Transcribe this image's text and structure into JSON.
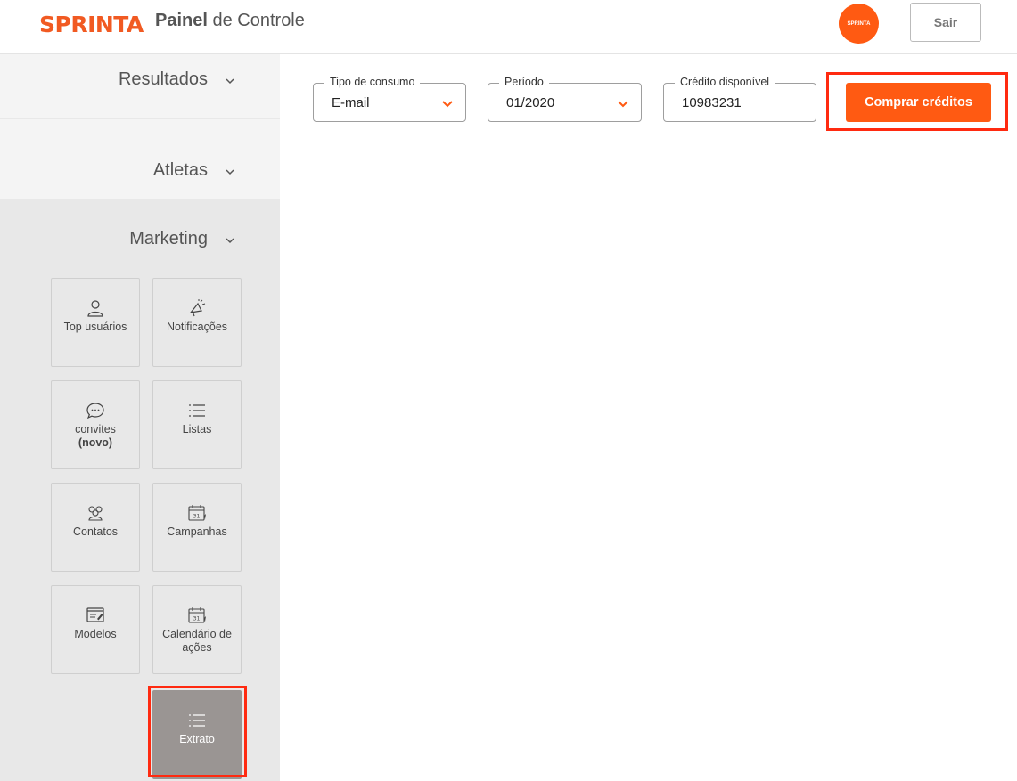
{
  "header": {
    "logo": "SPRINTA",
    "title_bold": "Painel",
    "title_rest": " de Controle",
    "avatar_text": "SPRINTA",
    "logout_label": "Sair"
  },
  "sidebar": {
    "sections": [
      {
        "label": "Resultados"
      },
      {
        "label": "Atletas"
      },
      {
        "label": "Marketing"
      }
    ],
    "tiles": [
      {
        "label": "Top usuários",
        "icon": "user-icon"
      },
      {
        "label": "Notificações",
        "icon": "megaphone-icon"
      },
      {
        "label": "convites",
        "sub": "(novo)",
        "icon": "chat-bubble-icon"
      },
      {
        "label": "Listas",
        "icon": "list-icon"
      },
      {
        "label": "Contatos",
        "icon": "group-icon"
      },
      {
        "label": "Campanhas",
        "icon": "calendar-icon"
      },
      {
        "label": "Modelos",
        "icon": "template-icon"
      },
      {
        "label": "Calendário de ações",
        "icon": "calendar-icon"
      },
      {
        "label": "Extrato",
        "icon": "list-icon",
        "active": true
      }
    ]
  },
  "filters": {
    "consumption_type": {
      "label": "Tipo de consumo",
      "value": "E-mail"
    },
    "period": {
      "label": "Período",
      "value": "01/2020"
    },
    "credit": {
      "label": "Crédito disponível",
      "value": "10983231"
    },
    "buy_label": "Comprar créditos"
  },
  "colors": {
    "brand": "#f15a22",
    "button": "#ff5a12",
    "highlight": "#ff2a10",
    "active_tile": "#9a9593"
  }
}
